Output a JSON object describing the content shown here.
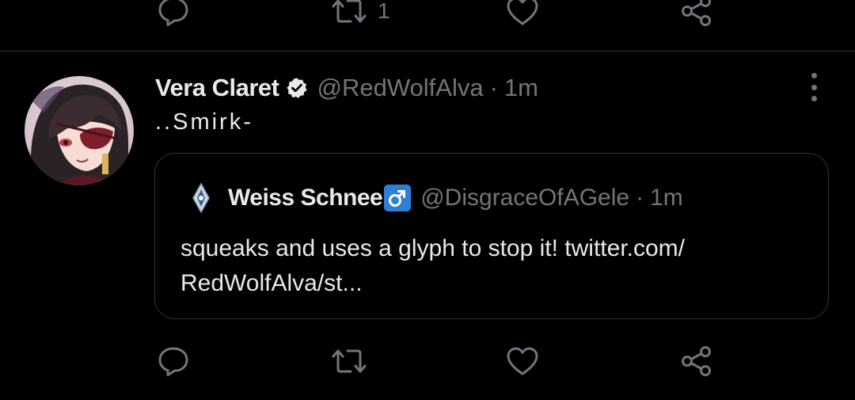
{
  "prev_tweet": {
    "actions": {
      "retweet_count": "1"
    },
    "icons": [
      "reply-icon",
      "retweet-icon",
      "like-icon",
      "share-icon"
    ]
  },
  "tweet": {
    "author_name": "Vera Claret",
    "handle": "@RedWolfAlva",
    "separator": "·",
    "time": "1m",
    "text": "..Smirk-",
    "verified": true,
    "quote": {
      "author_name": "Weiss Schnee",
      "handle": "@DisgraceOfAGele",
      "separator": "·",
      "time": "1m",
      "text_line1": "squeaks and uses a glyph to stop it! twitter.com/",
      "text_line2": "RedWolfAlva/st..."
    },
    "icons": [
      "reply-icon",
      "retweet-icon",
      "like-icon",
      "share-icon",
      "more-options-icon"
    ]
  },
  "colors": {
    "background": "#000000",
    "primary_text": "#e7e9ea",
    "secondary_text": "#71767b",
    "border": "#2f3336",
    "male_badge": "#2f7fd6"
  }
}
